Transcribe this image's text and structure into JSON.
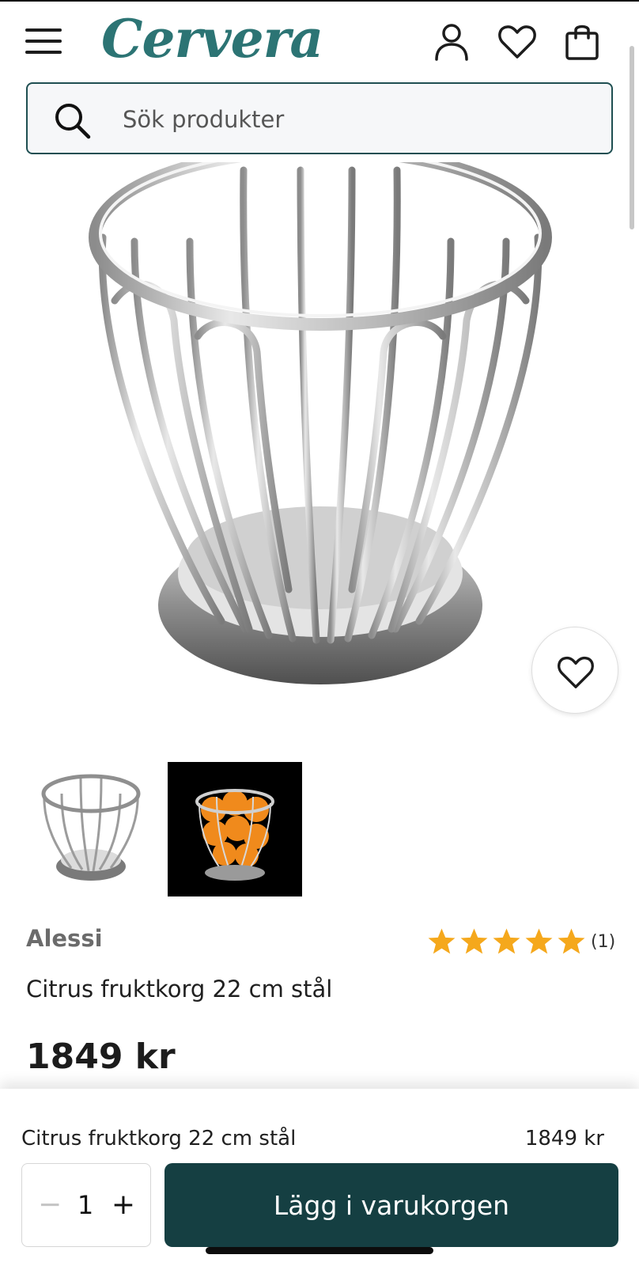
{
  "header": {
    "logo_text": "Cervera",
    "menu_icon": "hamburger-menu-icon",
    "account_icon": "user-icon",
    "wishlist_icon": "heart-icon",
    "cart_icon": "shopping-bag-icon",
    "brand_color": "#2c7474"
  },
  "search": {
    "placeholder": "Sök produkter",
    "icon": "search-icon"
  },
  "product": {
    "brand": "Alessi",
    "title": "Citrus fruktkorg 22 cm stål",
    "price": "1849 kr",
    "rating": {
      "stars": 5,
      "max": 5,
      "count_label": "(1)",
      "star_color": "#f5a81c"
    },
    "wishlist_button_icon": "heart-outline-icon",
    "thumbnails": [
      {
        "alt": "Citrus fruktkorg – stål",
        "selected": true
      },
      {
        "alt": "Citrus fruktkorg med apelsiner",
        "selected": false
      }
    ]
  },
  "sticky_bar": {
    "title": "Citrus fruktkorg 22 cm stål",
    "price": "1849 kr",
    "quantity": "1",
    "minus_label": "−",
    "plus_label": "+",
    "add_to_cart_label": "Lägg i varukorgen",
    "button_color": "#153f42"
  }
}
